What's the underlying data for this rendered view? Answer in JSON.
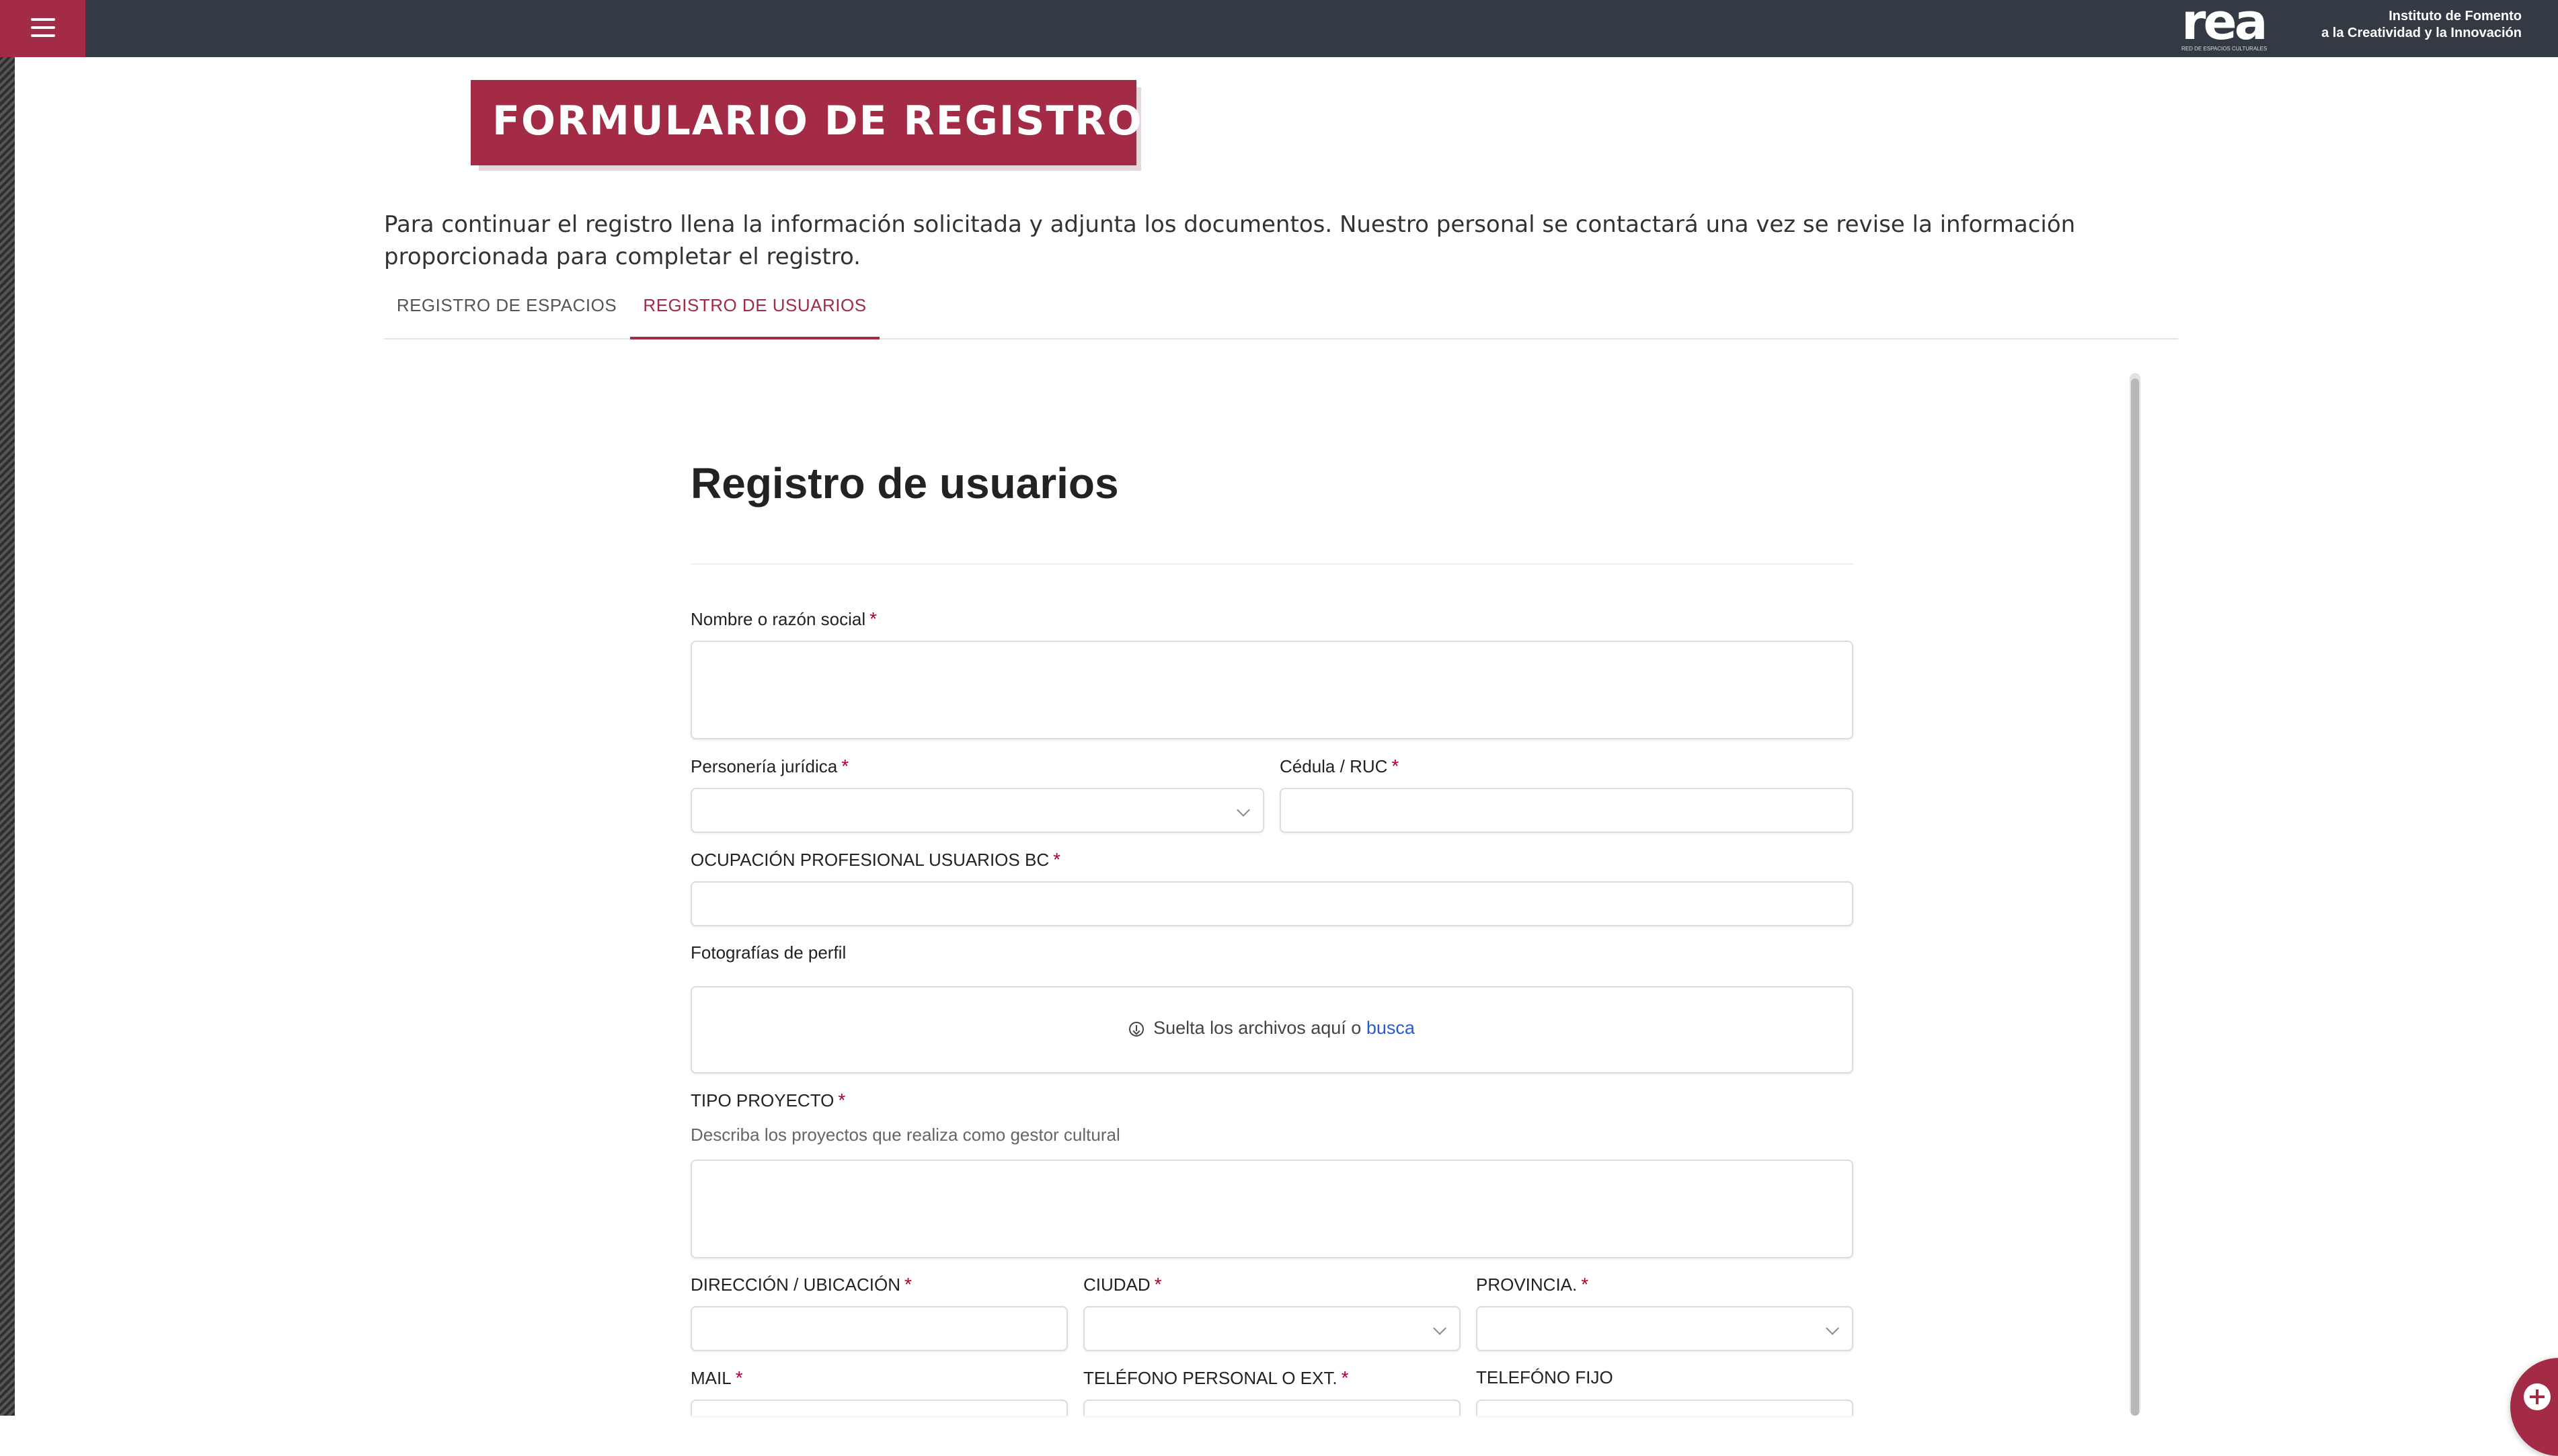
{
  "header": {
    "logo_text": "rea",
    "logo_subtitle": "RED DE ESPACIOS CULTURALES",
    "institute_line1": "Instituto de Fomento",
    "institute_line2": "a la Creatividad y la Innovación",
    "brand_color": "#a32b45",
    "bar_color": "#343a44"
  },
  "banner": {
    "title": "FORMULARIO DE REGISTRO"
  },
  "intro": "Para continuar el registro llena la información solicitada y adjunta los documentos. Nuestro personal se contactará una vez se revise la información proporcionada para completar el registro.",
  "tabs": [
    {
      "label": "REGISTRO DE ESPACIOS",
      "active": false
    },
    {
      "label": "REGISTRO DE USUARIOS",
      "active": true
    }
  ],
  "form": {
    "title": "Registro de usuarios",
    "fields": {
      "nombre": {
        "label": "Nombre o razón social",
        "required": "*",
        "value": ""
      },
      "personeria": {
        "label": "Personería jurídica",
        "required": "*",
        "selected": ""
      },
      "cedula": {
        "label": "Cédula / RUC",
        "required": "*",
        "value": ""
      },
      "ocupacion": {
        "label": "OCUPACIÓN PROFESIONAL USUARIOS BC",
        "required": "*",
        "value": ""
      },
      "fotografias": {
        "label": "Fotografías de perfil",
        "drop_text": "Suelta los archivos aquí o ",
        "browse_link": "busca"
      },
      "tipo_proyecto": {
        "label": "TIPO PROYECTO",
        "required": "*",
        "description": "Describa los proyectos que realiza como gestor cultural",
        "value": ""
      },
      "direccion": {
        "label": "DIRECCIÓN / UBICACIÓN",
        "required": "*",
        "value": ""
      },
      "ciudad": {
        "label": "CIUDAD",
        "required": "*",
        "selected": ""
      },
      "provincia": {
        "label": "PROVINCIA.",
        "required": "*",
        "selected": ""
      },
      "mail": {
        "label": "MAIL",
        "required": "*",
        "value": ""
      },
      "telefono_personal": {
        "label": "TELÉFONO PERSONAL O EXT.",
        "required": "*",
        "value": ""
      },
      "telefono_fijo": {
        "label": "TELEFÓNO FIJO",
        "value": ""
      }
    }
  },
  "icons": {
    "menu": "hamburger-icon",
    "upload": "download-circle-icon",
    "fab": "plus-circle-icon",
    "select": "chevron-down-icon"
  }
}
